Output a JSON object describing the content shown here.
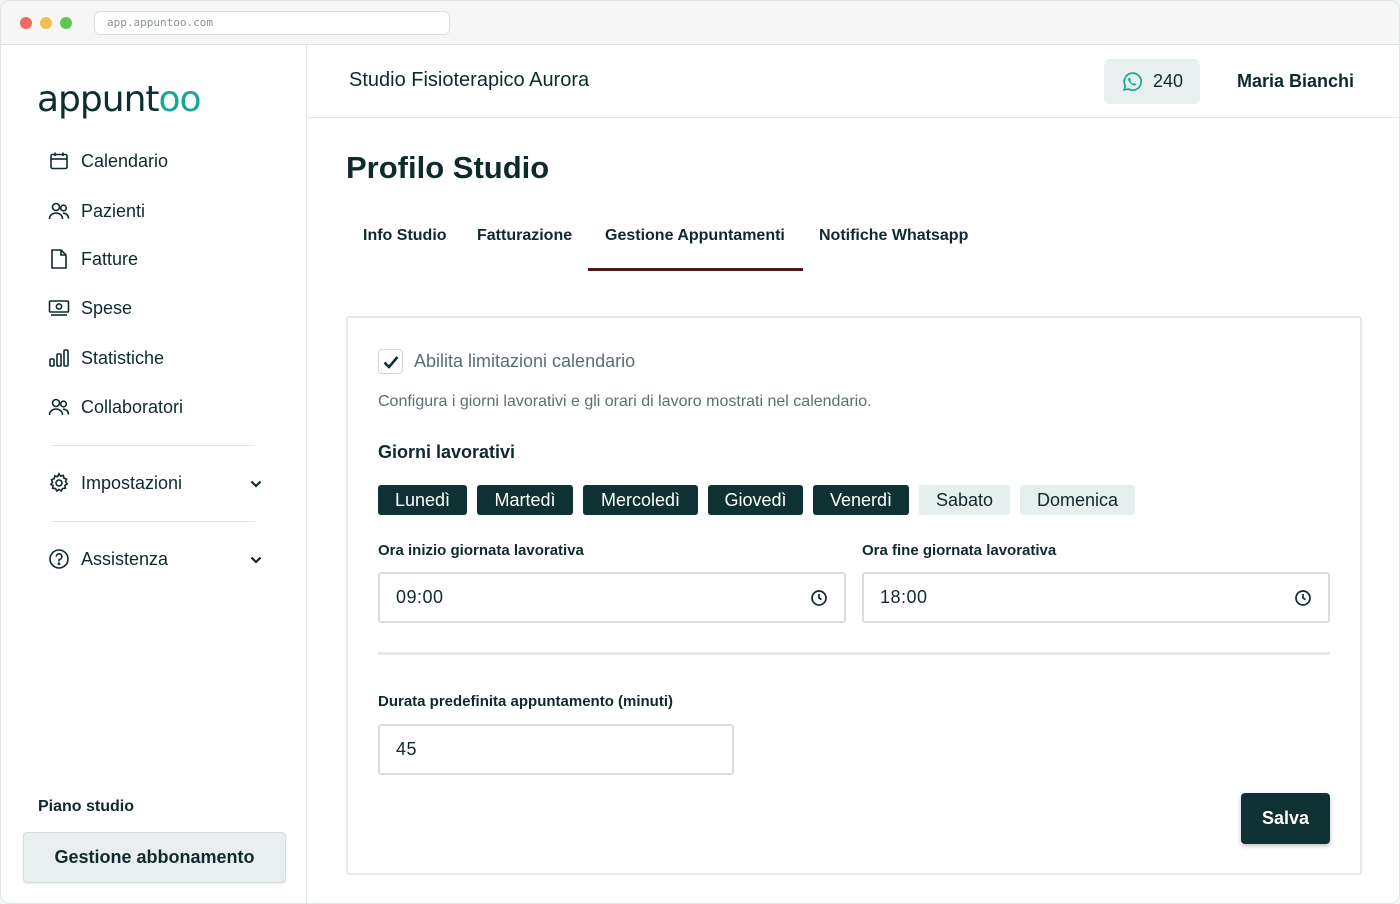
{
  "browser": {
    "url": "app.appuntoo.com"
  },
  "brand": {
    "logo_main": "appunt",
    "logo_accent": "oo",
    "accent_color": "#17a892",
    "dark_color": "#0e3133"
  },
  "sidebar": {
    "items": [
      {
        "label": "Calendario",
        "icon": "calendar-icon"
      },
      {
        "label": "Pazienti",
        "icon": "users-icon"
      },
      {
        "label": "Fatture",
        "icon": "file-icon"
      },
      {
        "label": "Spese",
        "icon": "money-icon"
      },
      {
        "label": "Statistiche",
        "icon": "bar-chart-icon"
      },
      {
        "label": "Collaboratori",
        "icon": "users-icon"
      }
    ],
    "settings": {
      "label": "Impostazioni",
      "icon": "gear-icon"
    },
    "help": {
      "label": "Assistenza",
      "icon": "help-circle-icon"
    },
    "plan_label": "Piano studio",
    "plan_button": "Gestione abbonamento"
  },
  "header": {
    "studio_name": "Studio Fisioterapico Aurora",
    "whatsapp_count": "240",
    "user_name": "Maria Bianchi"
  },
  "main": {
    "title": "Profilo Studio",
    "tabs": [
      {
        "label": "Info Studio",
        "active": false
      },
      {
        "label": "Fatturazione",
        "active": false
      },
      {
        "label": "Gestione Appuntamenti",
        "active": true
      },
      {
        "label": "Notifiche Whatsapp",
        "active": false
      }
    ],
    "card": {
      "checkbox_label": "Abilita limitazioni calendario",
      "checkbox_checked": true,
      "description": "Configura i giorni lavorativi e gli orari di lavoro mostrati nel calendario.",
      "days_title": "Giorni lavorativi",
      "days": [
        {
          "label": "Lunedì",
          "selected": true
        },
        {
          "label": "Martedì",
          "selected": true
        },
        {
          "label": "Mercoledì",
          "selected": true
        },
        {
          "label": "Giovedì",
          "selected": true
        },
        {
          "label": "Venerdì",
          "selected": true
        },
        {
          "label": "Sabato",
          "selected": false
        },
        {
          "label": "Domenica",
          "selected": false
        }
      ],
      "start_label": "Ora inizio giornata lavorativa",
      "start_value": "09:00",
      "end_label": "Ora fine giornata lavorativa",
      "end_value": "18:00",
      "duration_label": "Durata predefinita appuntamento (minuti)",
      "duration_value": "45",
      "save_label": "Salva"
    }
  }
}
